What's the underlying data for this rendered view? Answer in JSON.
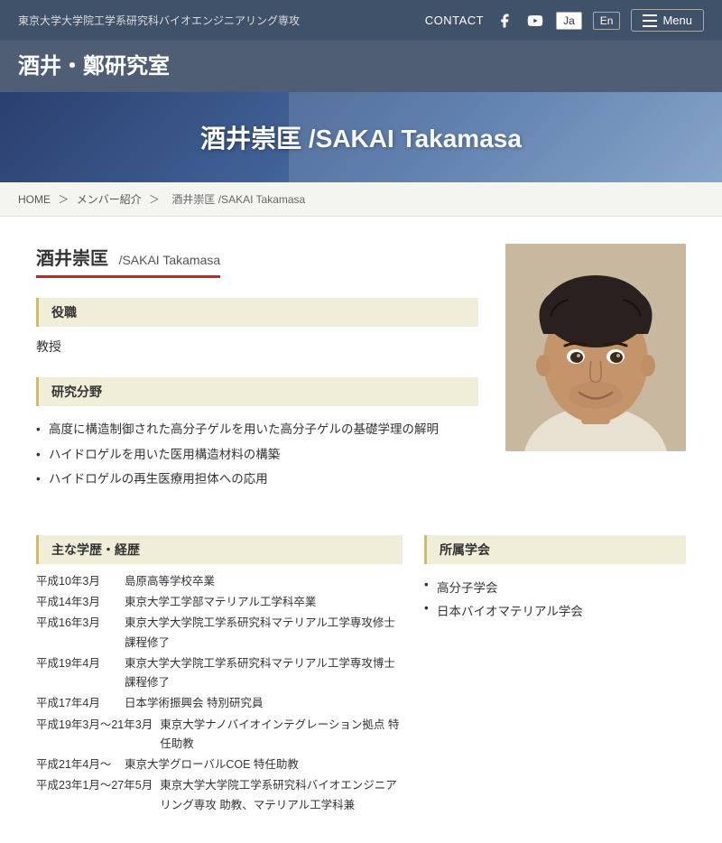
{
  "site": {
    "dept_name": "東京大学大学院工学系研究科バイオエンジニアリング専攻",
    "lab_name": "酒井・鄭研究室",
    "contact_label": "CONTACT",
    "lang_ja": "Ja",
    "lang_en": "En",
    "menu_label": "Menu"
  },
  "hero": {
    "title": "酒井崇匡 /SAKAI Takamasa"
  },
  "breadcrumb": {
    "home": "HOME",
    "members": "メンバー紹介",
    "current": "酒井崇匡 /SAKAI Takamasa"
  },
  "person": {
    "name_jp": "酒井崇匡",
    "name_roman": "/SAKAI Takamasa",
    "position_label": "役職",
    "position_value": "教授",
    "research_label": "研究分野",
    "research_items": [
      "高度に構造制御された高分子ゲルを用いた高分子ゲルの基礎学理の解明",
      "ハイドロゲルを用いた医用構造材料の構築",
      "ハイドロゲルの再生医療用担体への応用"
    ],
    "edu_label": "主な学歴・経歴",
    "edu_items": [
      {
        "date": "平成10年3月",
        "desc": "島原高等学校卒業"
      },
      {
        "date": "平成14年3月",
        "desc": "東京大学工学部マテリアル工学科卒業"
      },
      {
        "date": "平成16年3月",
        "desc": "東京大学大学院工学系研究科マテリアル工学専攻修士課程修了"
      },
      {
        "date": "平成19年4月",
        "desc": "東京大学大学院工学系研究科マテリアル工学専攻博士課程修了"
      },
      {
        "date": "平成17年4月",
        "desc": "日本学術振興会 特別研究員"
      },
      {
        "date": "平成19年3月～21年3月",
        "desc": "東京大学ナノバイオインテグレーション拠点 特任助教"
      },
      {
        "date": "平成21年4月～",
        "desc": "東京大学グローバルCOE 特任助教"
      },
      {
        "date": "平成23年1月～27年5月",
        "desc": "東京大学大学院工学系研究科バイオエンジニアリング専攻 助教、マテリアル工学科兼"
      }
    ],
    "society_label": "所属学会",
    "society_items": [
      "高分子学会",
      "日本バイオマテリアル学会"
    ]
  }
}
